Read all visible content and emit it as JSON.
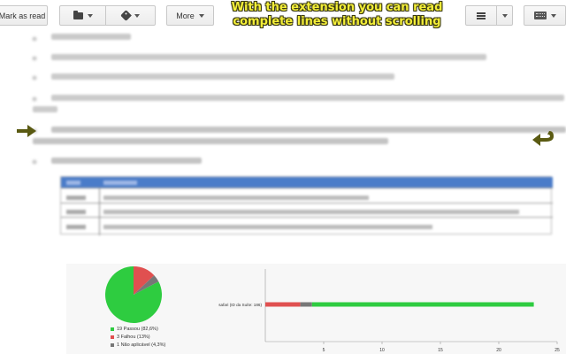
{
  "toolbar": {
    "mark_as_read": "Mark as read",
    "folder_icon": "folder-icon",
    "tag_icon": "tag-icon",
    "more_label": "More",
    "list_icon": "list-density-icon",
    "keyboard_icon": "keyboard-icon"
  },
  "headline": {
    "line1": "With the extension you can read",
    "line2": "complete lines without scrolling"
  },
  "colors": {
    "headline_text": "#f3ee38",
    "table_header": "#4a7cc9",
    "arrow": "#5a5a12",
    "pie_pass": "#2ecc40",
    "pie_fail": "#e05050",
    "pie_na": "#777777"
  },
  "chart_data": [
    {
      "type": "pie",
      "slices": [
        {
          "label": "19 Passou (82,6%)",
          "value": 82.6
        },
        {
          "label": "3 Falhou (13%)",
          "value": 13.0
        },
        {
          "label": "1 Não aplicável (4,3%)",
          "value": 4.3
        }
      ]
    },
    {
      "type": "bar",
      "categories": [
        "safari (ID da Suíte: 186)"
      ],
      "series": [
        {
          "values": [
            3
          ]
        },
        {
          "values": [
            1
          ]
        },
        {
          "values": [
            19
          ]
        }
      ],
      "xticks": [
        5,
        10,
        15,
        20,
        25
      ],
      "xlim": [
        0,
        25
      ]
    }
  ]
}
